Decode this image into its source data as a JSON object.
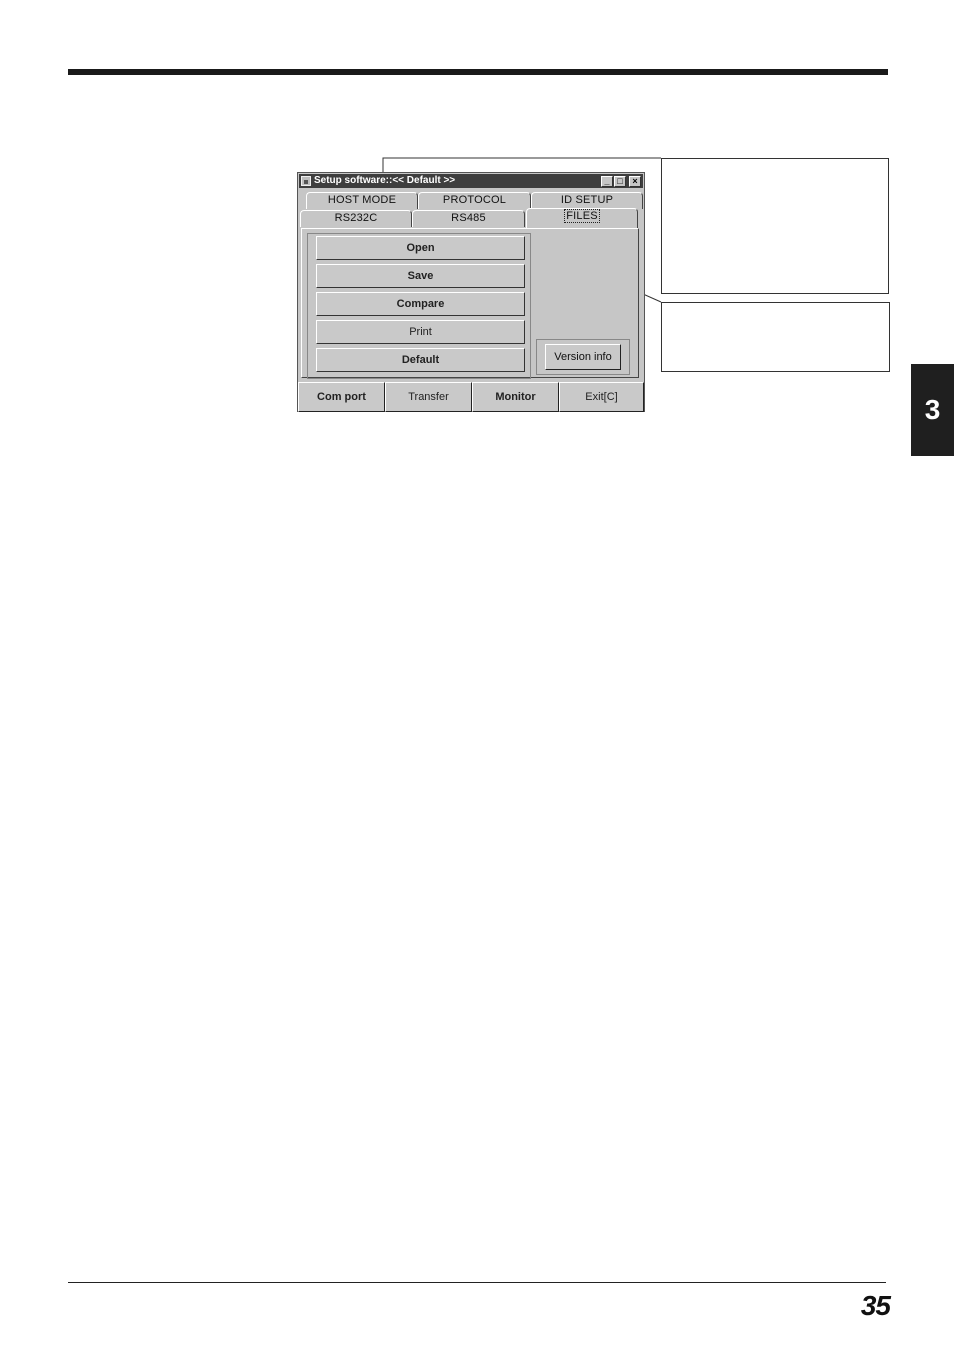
{
  "page": {
    "chapter_tab": "3",
    "page_number": "35"
  },
  "window": {
    "title": "Setup software::<< Default >>",
    "controls": {
      "minimize": "_",
      "maximize": "□",
      "close": "×"
    },
    "tabs_row1": [
      "HOST MODE",
      "PROTOCOL",
      "ID SETUP"
    ],
    "tabs_row2": [
      "RS232C",
      "RS485",
      "FILES"
    ],
    "active_tab": "FILES",
    "file_buttons": [
      "Open",
      "Save",
      "Compare",
      "Print",
      "Default"
    ],
    "version_button": "Version info",
    "footer_buttons": [
      "Com port",
      "Transfer",
      "Monitor",
      "Exit[C]"
    ]
  }
}
